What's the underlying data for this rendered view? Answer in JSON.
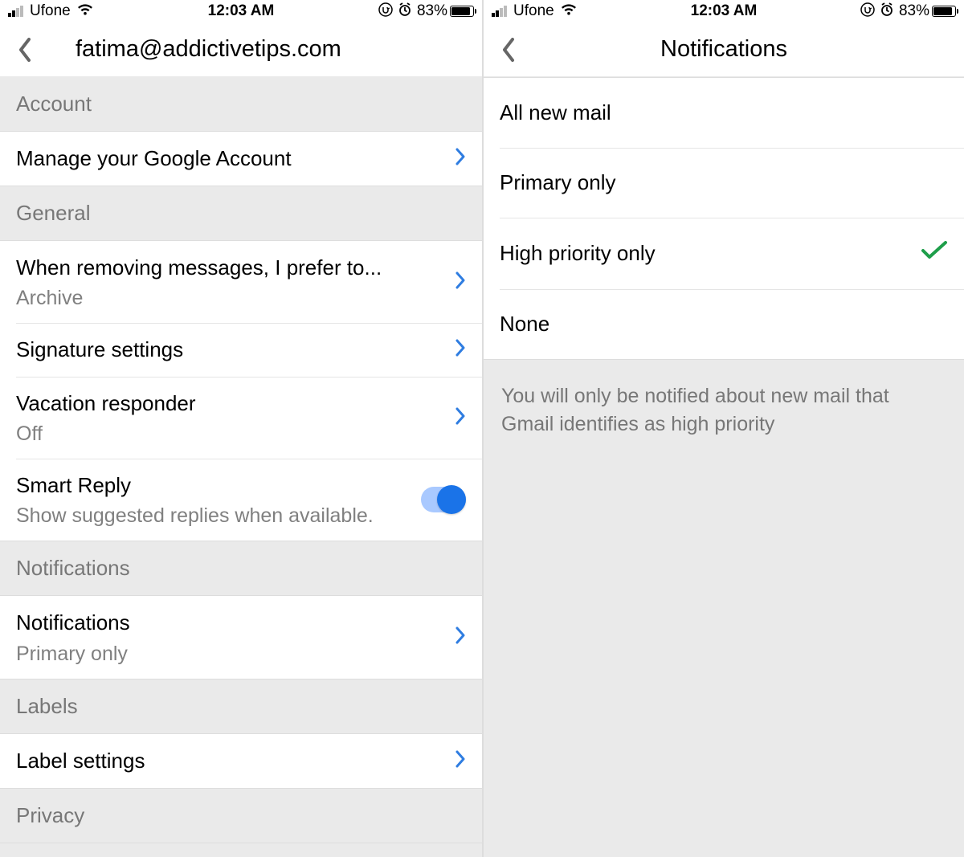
{
  "status": {
    "carrier": "Ufone",
    "time": "12:03 AM",
    "battery_percent": "83%"
  },
  "left": {
    "title": "fatima@addictivetips.com",
    "sections": {
      "account": {
        "header": "Account",
        "manage": "Manage your Google Account"
      },
      "general": {
        "header": "General",
        "remove_pref_title": "When removing messages, I prefer to...",
        "remove_pref_value": "Archive",
        "signature": "Signature settings",
        "vacation_title": "Vacation responder",
        "vacation_value": "Off",
        "smart_reply_title": "Smart Reply",
        "smart_reply_sub": "Show suggested replies when available.",
        "smart_reply_on": true
      },
      "notifications": {
        "header": "Notifications",
        "row_title": "Notifications",
        "row_value": "Primary only"
      },
      "labels": {
        "header": "Labels",
        "row_title": "Label settings"
      },
      "privacy": {
        "header": "Privacy"
      }
    }
  },
  "right": {
    "title": "Notifications",
    "options": [
      {
        "label": "All new mail",
        "selected": false
      },
      {
        "label": "Primary only",
        "selected": false
      },
      {
        "label": "High priority only",
        "selected": true
      },
      {
        "label": "None",
        "selected": false
      }
    ],
    "explain": "You will only be notified about new mail that Gmail identifies as high priority"
  }
}
